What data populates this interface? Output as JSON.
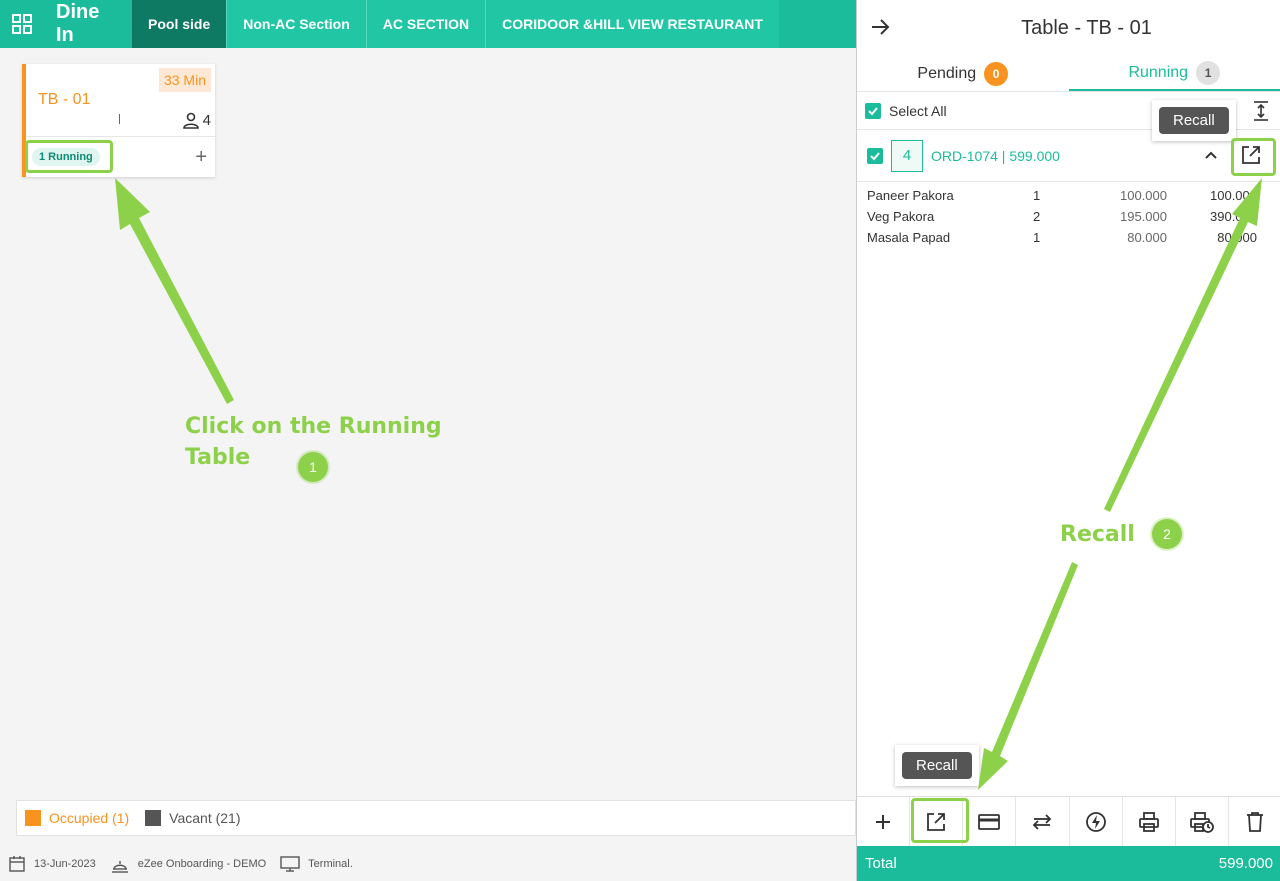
{
  "header": {
    "title": "Dine In",
    "tabs": [
      {
        "label": "Pool side",
        "active": true
      },
      {
        "label": "Non-AC Section"
      },
      {
        "label": "AC SECTION"
      },
      {
        "label": "CORIDOOR &HILL VIEW RESTAURANT"
      }
    ]
  },
  "table_card": {
    "name": "TB - 01",
    "time": "33 Min",
    "guests": "4",
    "running_label": "1 Running"
  },
  "legend": {
    "occupied": "Occupied (1)",
    "vacant": "Vacant (21)"
  },
  "status_bar": {
    "date": "13-Jun-2023",
    "property": "eZee Onboarding - DEMO",
    "terminal": "Terminal."
  },
  "panel": {
    "title": "Table - TB - 01",
    "tabs": [
      {
        "label": "Pending",
        "count": "0"
      },
      {
        "label": "Running",
        "count": "1"
      }
    ],
    "select_all": "Select All",
    "order": {
      "seat": "4",
      "label": "ORD-1074 | 599.000"
    },
    "items": [
      {
        "name": "Paneer Pakora",
        "qty": "1",
        "rate": "100.000",
        "total": "100.000"
      },
      {
        "name": "Veg Pakora",
        "qty": "2",
        "rate": "195.000",
        "total": "390.000"
      },
      {
        "name": "Masala Papad",
        "qty": "1",
        "rate": "80.000",
        "total": "80.000"
      }
    ],
    "tooltip_top": "Recall",
    "tooltip_bottom": "Recall",
    "total_label": "Total",
    "total_value": "599.000"
  },
  "annotations": {
    "step1_text_line1": "Click on the Running",
    "step1_text_line2": "Table",
    "step1_number": "1",
    "step2_text": "Recall",
    "step2_number": "2"
  },
  "colors": {
    "accent": "#1bbc9b",
    "occupied": "#f7931e",
    "vacant": "#555555",
    "annotation": "#8dd14a"
  }
}
